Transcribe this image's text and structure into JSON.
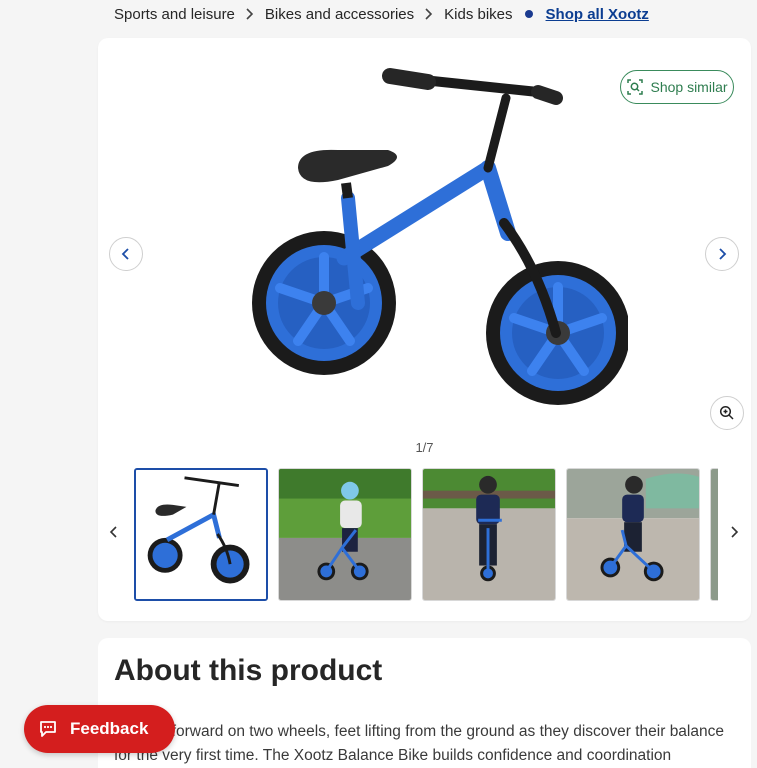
{
  "breadcrumb": {
    "items": [
      "Sports and leisure",
      "Bikes and accessories",
      "Kids bikes"
    ],
    "shop_all": "Shop all Xootz"
  },
  "gallery": {
    "shop_similar": "Shop similar",
    "counter": "1/7",
    "thumbnail_count_visible": 5,
    "selected_index": 0
  },
  "about": {
    "title": "About this product",
    "text": "...glides forward on two wheels, feet lifting from the ground as they discover their balance for the very first time. The Xootz Balance Bike builds confidence and coordination"
  },
  "feedback": {
    "label": "Feedback"
  },
  "colors": {
    "brand_blue": "#1d4ea8",
    "link_blue": "#0b3d91",
    "shop_similar_green": "#2e7d4f",
    "feedback_red": "#d41e1e",
    "bike_blue": "#2e6fd8"
  },
  "icons": [
    "chevron-right-icon",
    "chevron-left-icon",
    "camera-search-icon",
    "zoom-in-icon",
    "chat-icon"
  ]
}
